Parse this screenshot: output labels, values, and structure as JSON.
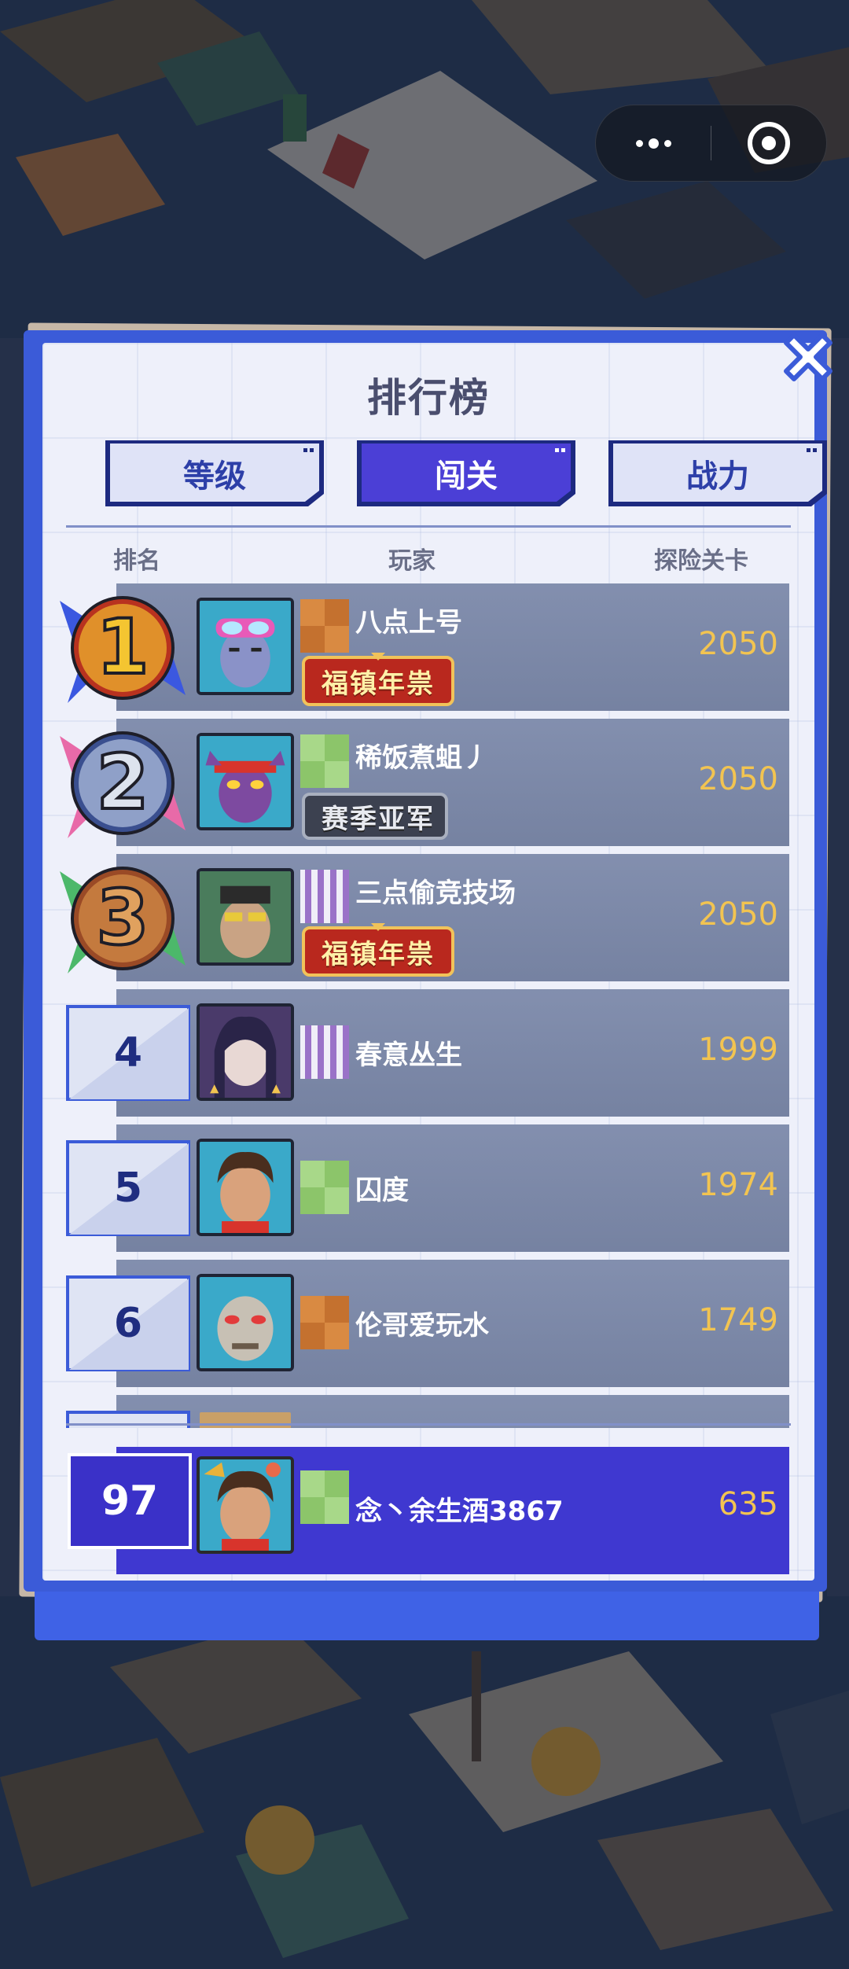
{
  "capsule": {
    "more_icon": "more-dots-icon",
    "close_icon": "mini-program-close-icon"
  },
  "panel": {
    "title": "排行榜",
    "close_icon": "close-x-icon",
    "tabs": [
      {
        "label": "等级",
        "active": false
      },
      {
        "label": "闯关",
        "active": true
      },
      {
        "label": "战力",
        "active": false
      }
    ],
    "headers": {
      "rank": "排名",
      "player": "玩家",
      "stage": "探险关卡"
    }
  },
  "rows": [
    {
      "rank": "1",
      "name": "八点上号",
      "score": "2050",
      "badge": "福镇年祟",
      "flag": "orange"
    },
    {
      "rank": "2",
      "name": "稀饭煮蛆丿",
      "score": "2050",
      "badge": "赛季亚军",
      "flag": "green"
    },
    {
      "rank": "3",
      "name": "三点偷竞技场",
      "score": "2050",
      "badge": "福镇年祟",
      "flag": "purple"
    },
    {
      "rank": "4",
      "name": "春意丛生",
      "score": "1999",
      "badge": "",
      "flag": "purple"
    },
    {
      "rank": "5",
      "name": "囚度",
      "score": "1974",
      "badge": "",
      "flag": "green"
    },
    {
      "rank": "6",
      "name": "伦哥爱玩水",
      "score": "1749",
      "badge": "",
      "flag": "orange"
    }
  ],
  "self": {
    "rank": "97",
    "name": "念丶余生酒3867",
    "score": "635",
    "flag": "green"
  },
  "colors": {
    "panel_frame": "#3b5bd8",
    "tab_active": "#4b3fd6",
    "row_bg": "#7c89aa",
    "self_bg": "#3f38d0",
    "score": "#f2c451",
    "medal_gold": "#f4c531",
    "medal_silver": "#dde3ee",
    "medal_bronze": "#e0a15e"
  }
}
